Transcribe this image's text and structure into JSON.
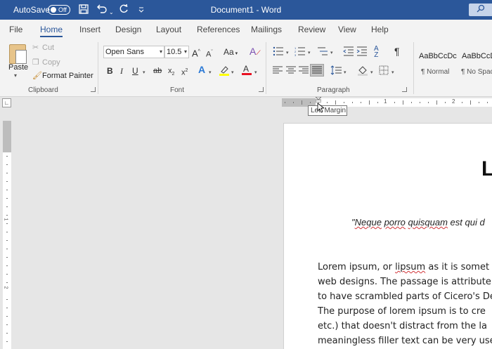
{
  "titlebar": {
    "autosave_label": "AutoSave",
    "autosave_state": "Off",
    "title": "Document1  -  Word",
    "icons": [
      "save-icon",
      "undo-icon",
      "redo-icon",
      "customize-qat-icon",
      "search-icon"
    ]
  },
  "tabs": [
    "File",
    "Home",
    "Insert",
    "Design",
    "Layout",
    "References",
    "Mailings",
    "Review",
    "View",
    "Help"
  ],
  "active_tab": "Home",
  "clipboard": {
    "paste": "Paste",
    "cut": "Cut",
    "copy": "Copy",
    "format_painter": "Format Painter",
    "label": "Clipboard"
  },
  "font": {
    "family": "Open Sans",
    "size": "10.5",
    "change_case": "Aa",
    "label": "Font"
  },
  "paragraph": {
    "label": "Paragraph"
  },
  "styles": [
    {
      "sample": "AaBbCcDc",
      "name": "¶ Normal"
    },
    {
      "sample": "AaBbCcDc",
      "name": "¶ No Spac"
    }
  ],
  "ruler": {
    "numbers": [
      "1",
      "2"
    ],
    "tooltip": "Left Margin"
  },
  "vruler": {
    "numbers": [
      "1",
      "2"
    ]
  },
  "document": {
    "title": "L",
    "quote": "\"Neque porro quisquam est qui d",
    "body_lines": [
      "Lorem ipsum, or lipsum as it is somet",
      "web designs. The passage is attribute",
      "to have scrambled parts of Cicero's De",
      "The purpose of lorem ipsum is to cre",
      "etc.) that doesn't distract from the la",
      "meaningless filler text can be very use"
    ]
  },
  "colors": {
    "title_bar": "#2b579a",
    "ribbon": "#f3f3f3",
    "font_color_underline": "#e81123",
    "highlight_underline": "#ffff00"
  }
}
